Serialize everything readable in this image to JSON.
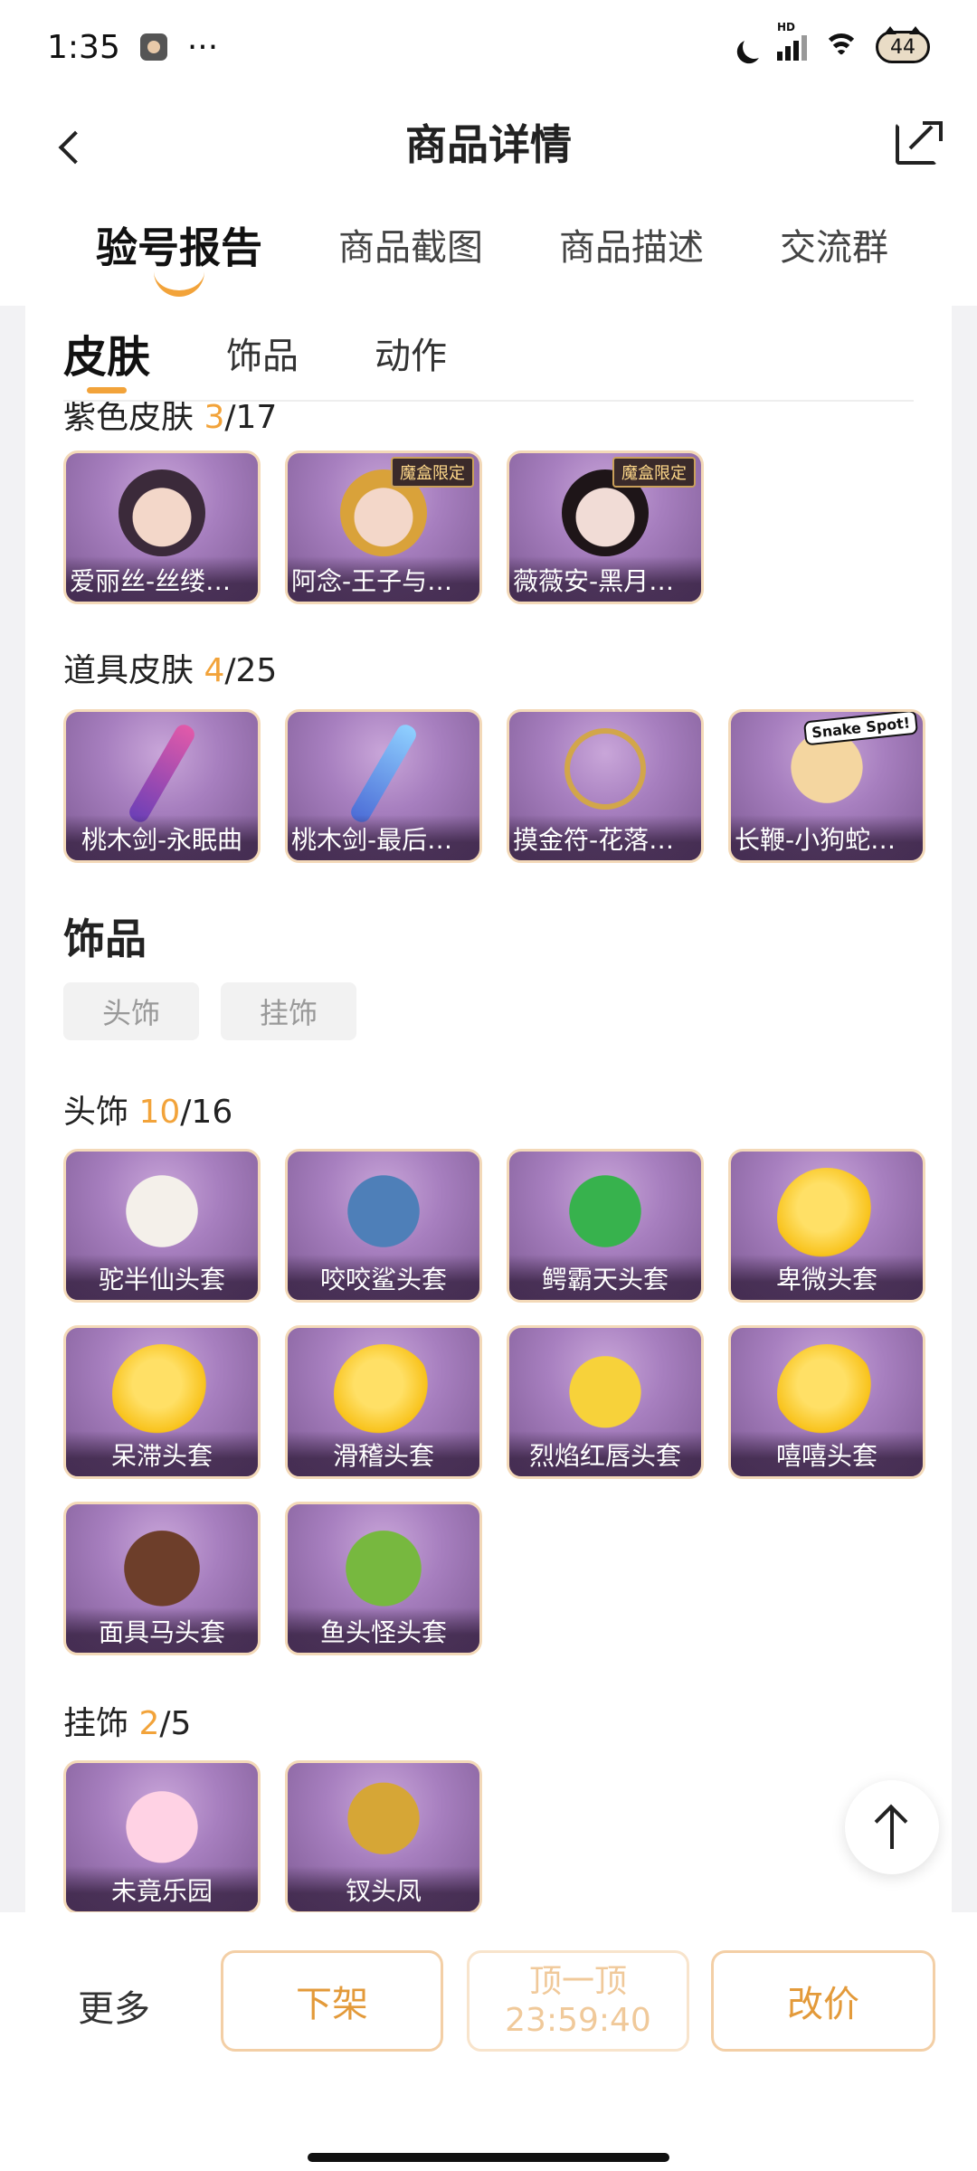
{
  "status": {
    "time": "1:35",
    "more": "···",
    "battery": "44",
    "hd": "HD"
  },
  "header": {
    "title": "商品详情"
  },
  "main_tabs": [
    {
      "label": "验号报告",
      "active": true
    },
    {
      "label": "商品截图"
    },
    {
      "label": "商品描述"
    },
    {
      "label": "交流群"
    }
  ],
  "sub_tabs": [
    {
      "label": "皮肤",
      "active": true
    },
    {
      "label": "饰品"
    },
    {
      "label": "动作"
    }
  ],
  "sections": {
    "purple": {
      "title": "紫色皮肤",
      "count": "3",
      "total": "/17"
    },
    "prop": {
      "title": "道具皮肤",
      "count": "4",
      "total": "/25"
    },
    "head": {
      "title": "头饰",
      "count": "10",
      "total": "/16"
    },
    "hang": {
      "title": "挂饰",
      "count": "2",
      "total": "/5"
    }
  },
  "accessories": {
    "title": "饰品",
    "chips": [
      "头饰",
      "挂饰"
    ]
  },
  "purple_skins": [
    {
      "name": "爱丽丝-丝缕哀歌"
    },
    {
      "name": "阿念-王子与骑士",
      "badge": "魔盒限定"
    },
    {
      "name": "薇薇安-黑月挽歌",
      "badge": "魔盒限定"
    }
  ],
  "prop_skins": [
    {
      "name": "桃木剑-永眠曲"
    },
    {
      "name": "桃木剑-最后的..."
    },
    {
      "name": "摸金符-花落精绝"
    },
    {
      "name": "长鞭-小狗蛇点...",
      "sticker": "Snake Spot!"
    }
  ],
  "head_items": [
    {
      "name": "驼半仙头套"
    },
    {
      "name": "咬咬鲨头套"
    },
    {
      "name": "鳄霸天头套"
    },
    {
      "name": "卑微头套"
    },
    {
      "name": "呆滞头套"
    },
    {
      "name": "滑稽头套"
    },
    {
      "name": "烈焰红唇头套"
    },
    {
      "name": "嘻嘻头套"
    },
    {
      "name": "面具马头套"
    },
    {
      "name": "鱼头怪头套"
    }
  ],
  "hang_items": [
    {
      "name": "未竟乐园"
    },
    {
      "name": "钗头凤"
    }
  ],
  "bottom": {
    "more": "更多",
    "delist": "下架",
    "boost": "顶一顶",
    "countdown": "23:59:40",
    "reprice": "改价"
  },
  "colors": {
    "accent": "#f2a33a",
    "button_text": "#e39a3a"
  }
}
